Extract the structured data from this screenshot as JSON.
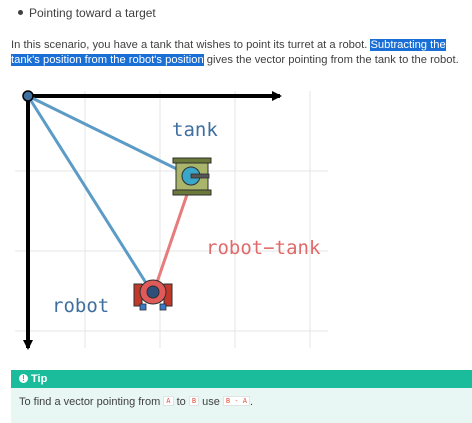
{
  "bullet": {
    "text": "Pointing toward a target"
  },
  "paragraph": {
    "part1": "In this scenario, you have a tank that wishes to point its turret at a robot. ",
    "highlight": "Subtracting the tank's position from the robot's position",
    "part2": " gives the vector pointing from the tank to the robot."
  },
  "figure": {
    "tank_label": "tank",
    "robot_tank_label": "robot−tank",
    "robot_label": "robot",
    "colors": {
      "axes": "#000000",
      "blue_vectors": "#5b9bc6",
      "difference_vector": "#e87b7b",
      "grid": "#e6e6e6"
    }
  },
  "tip": {
    "title": "Tip",
    "text_before": "To find a vector pointing from ",
    "code_a": "A",
    "word_to": " to ",
    "code_b": "B",
    "word_use": " use ",
    "code_ba": "B - A",
    "text_after": "."
  },
  "colors": {
    "tip_header": "#1abc9c",
    "tip_background": "#e8f7f3",
    "highlight": "#1a6fd6"
  }
}
